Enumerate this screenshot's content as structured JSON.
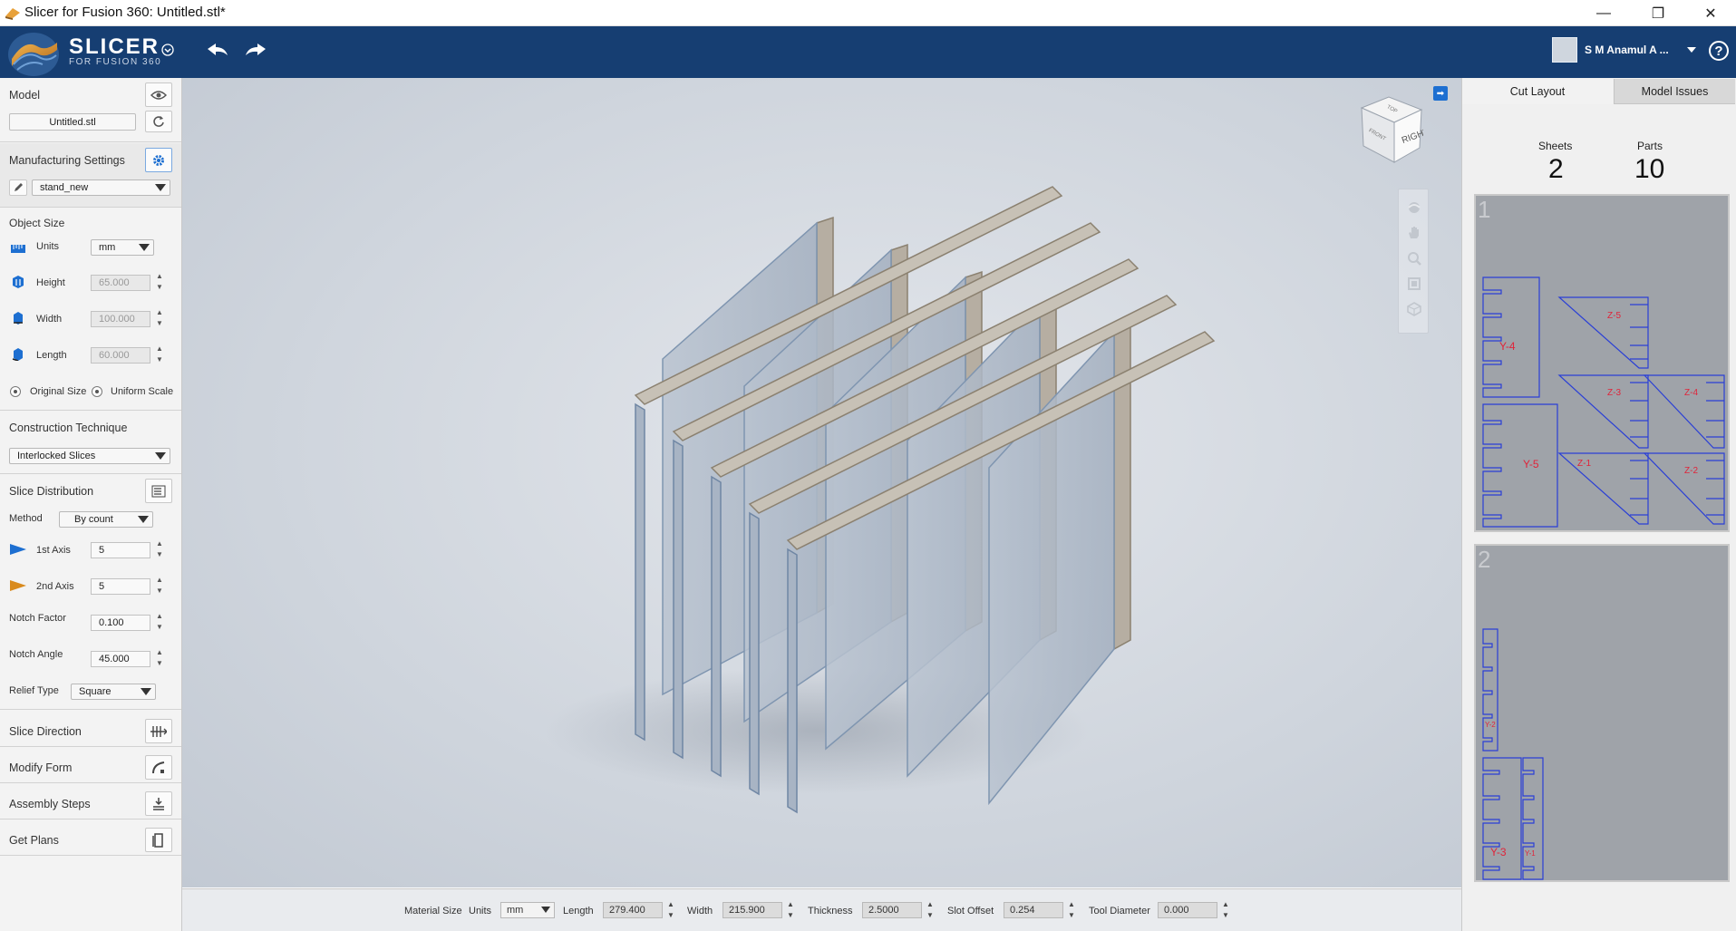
{
  "window": {
    "title": "Slicer for Fusion 360: Untitled.stl*",
    "controls": [
      "—",
      "❐",
      "✕"
    ]
  },
  "header": {
    "logo_text": "SLICER",
    "logo_subtext": "FOR FUSION 360",
    "user_name": "S M Anamul A ...",
    "help_label": "?"
  },
  "left_panel": {
    "model": {
      "label": "Model",
      "file_button": "Untitled.stl"
    },
    "manufacturing": {
      "label": "Manufacturing Settings",
      "preset": "stand_new"
    },
    "object_size": {
      "label": "Object Size",
      "units_label": "Units",
      "units_value": "mm",
      "height_label": "Height",
      "height_value": "65.000",
      "width_label": "Width",
      "width_value": "100.000",
      "length_label": "Length",
      "length_value": "60.000",
      "original_size": "Original Size",
      "uniform_scale": "Uniform Scale"
    },
    "construction": {
      "label": "Construction Technique",
      "value": "Interlocked Slices"
    },
    "slice_distribution": {
      "label": "Slice Distribution",
      "method_label": "Method",
      "method_value": "By count",
      "axis1_label": "1st Axis",
      "axis1_value": "5",
      "axis2_label": "2nd Axis",
      "axis2_value": "5",
      "notch_factor_label": "Notch Factor",
      "notch_factor_value": "0.100",
      "notch_angle_label": "Notch Angle",
      "notch_angle_value": "45.000",
      "relief_type_label": "Relief Type",
      "relief_type_value": "Square"
    },
    "sections": {
      "slice_direction": "Slice Direction",
      "modify_form": "Modify Form",
      "assembly_steps": "Assembly Steps",
      "get_plans": "Get Plans"
    }
  },
  "viewport": {
    "viewcube_faces": {
      "right": "RIGHT",
      "front": "FRONT",
      "top": "TOP"
    }
  },
  "material_bar": {
    "material_size": "Material Size",
    "units_label": "Units",
    "units_value": "mm",
    "length_label": "Length",
    "length_value": "279.400",
    "width_label": "Width",
    "width_value": "215.900",
    "thickness_label": "Thickness",
    "thickness_value": "2.5000",
    "slot_offset_label": "Slot Offset",
    "slot_offset_value": "0.254",
    "tool_diameter_label": "Tool Diameter",
    "tool_diameter_value": "0.000"
  },
  "right_panel": {
    "tabs": [
      "Cut Layout",
      "Model Issues"
    ],
    "active_tab": "Cut Layout",
    "sheets_label": "Sheets",
    "sheets_value": "2",
    "parts_label": "Parts",
    "parts_value": "10",
    "sheet_numbers": [
      "1",
      "2"
    ],
    "part_labels": {
      "sheet1": [
        "Y-4",
        "Y-5",
        "Z-5",
        "Z-3",
        "Z-4",
        "Z-1",
        "Z-2"
      ],
      "sheet2": [
        "Y-2",
        "Y-3",
        "Y-1"
      ]
    }
  },
  "colors": {
    "header_bg": "#163e72",
    "accent_blue": "#1d6fd1",
    "part_outline": "#2a3fd6",
    "part_label": "#e0243a",
    "sheet_bg": "#9fa3a9"
  }
}
